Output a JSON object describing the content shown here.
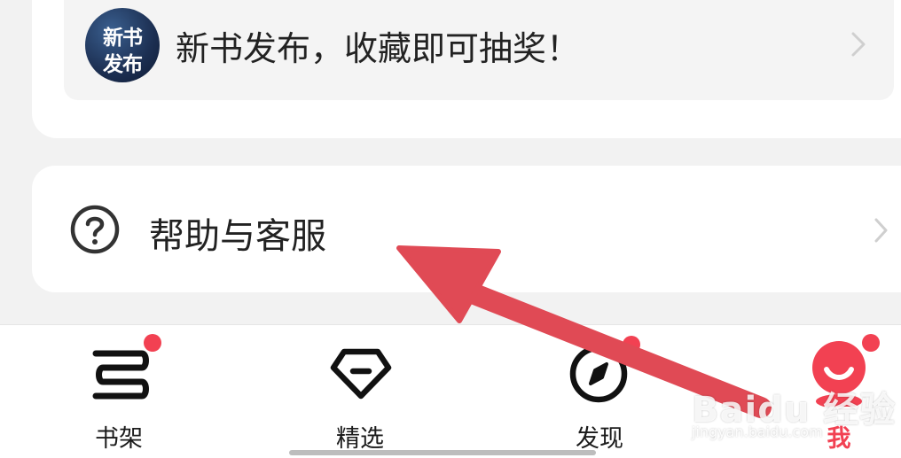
{
  "promo": {
    "avatar_line1": "新书",
    "avatar_line2": "发布",
    "text": "新书发布，收藏即可抽奖！"
  },
  "help": {
    "label": "帮助与客服"
  },
  "tabs": [
    {
      "label": "书架",
      "icon": "bookshelf-icon",
      "badge": true
    },
    {
      "label": "精选",
      "icon": "diamond-icon",
      "badge": false
    },
    {
      "label": "发现",
      "icon": "compass-icon",
      "badge": true
    },
    {
      "label": "我",
      "icon": "profile-icon",
      "badge": true,
      "active": true
    }
  ],
  "watermark": {
    "main": "Baidu 经验",
    "sub": "jingyan.baidu.com"
  },
  "colors": {
    "accent": "#f24152",
    "annotation_arrow": "#e04a55"
  }
}
